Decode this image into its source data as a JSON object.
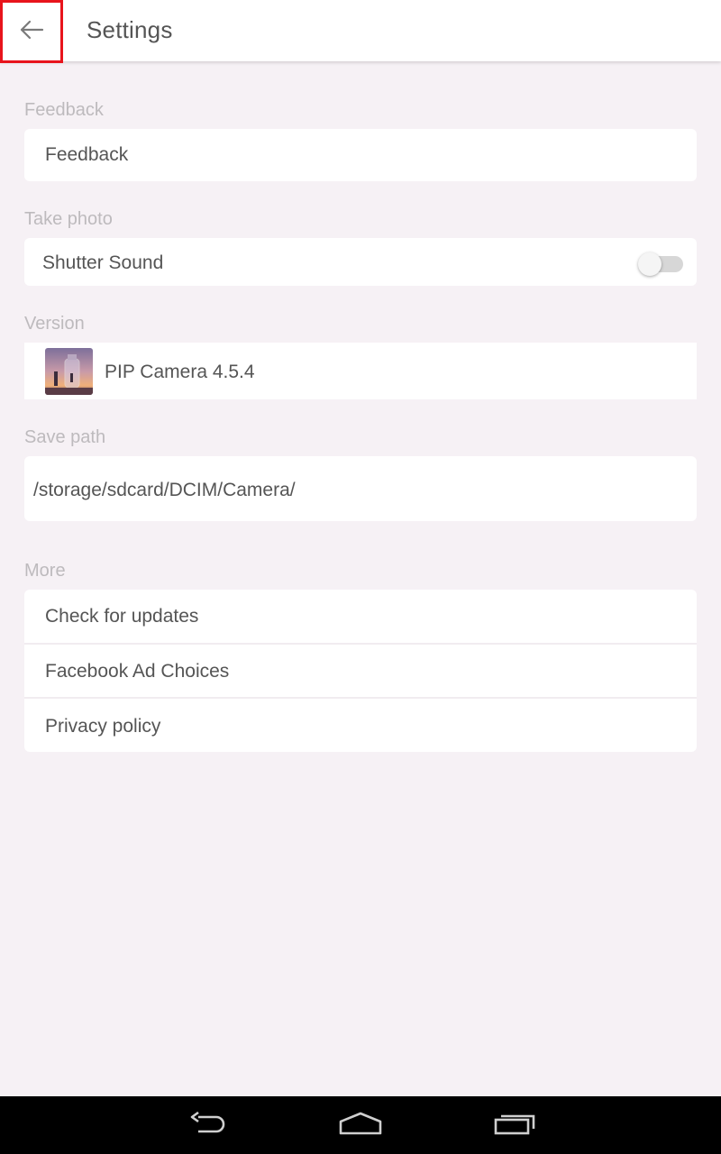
{
  "header": {
    "title": "Settings",
    "back_icon": "arrow-left-icon"
  },
  "sections": {
    "feedback": {
      "label": "Feedback",
      "item": "Feedback"
    },
    "take_photo": {
      "label": "Take photo",
      "shutter_sound": "Shutter Sound",
      "shutter_sound_enabled": false
    },
    "version": {
      "label": "Version",
      "app_version": "PIP Camera 4.5.4"
    },
    "save_path": {
      "label": "Save path",
      "path": "/storage/sdcard/DCIM/Camera/"
    },
    "more": {
      "label": "More",
      "items": [
        "Check for updates",
        "Facebook Ad Choices",
        "Privacy policy"
      ]
    }
  },
  "navbar": {
    "icons": [
      "back-icon",
      "home-icon",
      "recent-apps-icon"
    ]
  },
  "colors": {
    "background": "#f6f1f5",
    "card": "#ffffff",
    "text": "#555555",
    "label": "#bdbabd",
    "highlight": "#e8141c"
  }
}
